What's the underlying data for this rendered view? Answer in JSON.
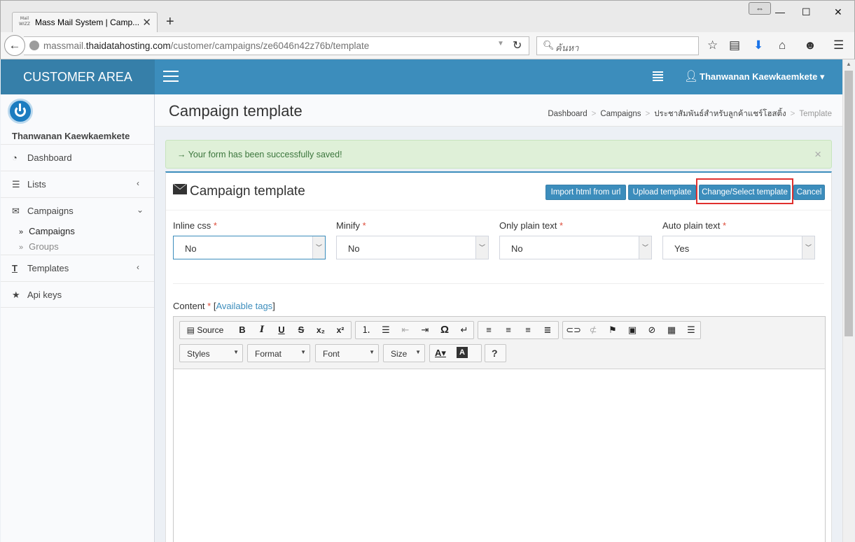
{
  "browser": {
    "tab_favicon": "Mail\nWIZZ",
    "tab_title": "Mass Mail System | Camp...",
    "tab_close": "✕",
    "new_tab": "+",
    "url_host": "massmail.",
    "url_domain": "thaidatahosting.com",
    "url_path": "/customer/campaigns/ze6046n42z76b/template",
    "search_placeholder": "ค้นหา",
    "minimize": "—",
    "maximize": "☐",
    "close": "✕"
  },
  "header": {
    "logo": "CUSTOMER AREA",
    "user_name": "Thanwanan Kaewkaemkete",
    "caret": "▾"
  },
  "sidebar": {
    "user_name": "Thanwanan Kaewkaemkete",
    "items": [
      {
        "label": "Dashboard",
        "icon": "dashboard-icon"
      },
      {
        "label": "Lists",
        "icon": "list-icon"
      },
      {
        "label": "Campaigns",
        "icon": "envelope-icon"
      },
      {
        "label": "Templates",
        "icon": "text-icon"
      },
      {
        "label": "Api keys",
        "icon": "star-icon"
      }
    ],
    "sub_items": [
      {
        "label": "Campaigns"
      },
      {
        "label": "Groups"
      }
    ]
  },
  "page": {
    "title": "Campaign template",
    "breadcrumb": [
      "Dashboard",
      "Campaigns",
      "ประชาสัมพันธ์สำหรับลูกค้าแชร์โฮสติ้ง",
      "Template"
    ],
    "alert": "→ Your form has been successfully saved!",
    "alert_close": "×"
  },
  "box": {
    "title": "Campaign template",
    "buttons": {
      "import": "Import html from url",
      "upload": "Upload template",
      "change": "Change/Select template",
      "cancel": "Cancel"
    },
    "fields": [
      {
        "label": "Inline css",
        "value": "No"
      },
      {
        "label": "Minify",
        "value": "No"
      },
      {
        "label": "Only plain text",
        "value": "No"
      },
      {
        "label": "Auto plain text",
        "value": "Yes"
      }
    ],
    "required_mark": "*",
    "content_label": "Content",
    "available_tags": "Available tags"
  },
  "editor": {
    "source_label": "Source",
    "combos": [
      "Styles",
      "Format",
      "Font",
      "Size"
    ],
    "help": "?"
  },
  "colors": {
    "brand": "#3c8dbc",
    "brand_dark": "#367fa9",
    "success_bg": "#dff0d8",
    "highlight": "#e0302e"
  }
}
